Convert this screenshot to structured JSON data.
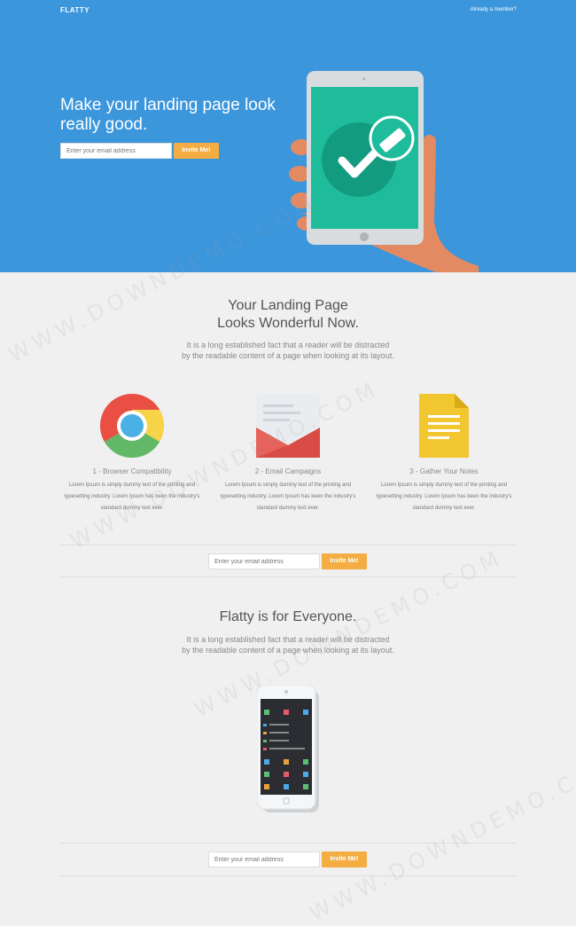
{
  "header": {
    "brand": "FLATTY",
    "member_link": "Already a member?"
  },
  "hero": {
    "title": "Make your landing page look really good.",
    "email_placeholder": "Enter your email address",
    "button": "Invite Me!"
  },
  "section1": {
    "title_line1": "Your Landing Page",
    "title_line2": "Looks Wonderful Now.",
    "subtitle": "It is a long established fact that a reader will be distracted by the readable content of a page when looking at its layout."
  },
  "features": [
    {
      "title": "1 - Browser Compatibility",
      "body": "Lorem Ipsum is simply dummy text of the printing and typesetting industry. Lorem Ipsum has been the industry's standard dummy text ever.",
      "icon": "chrome-icon"
    },
    {
      "title": "2 - Email Campaigns",
      "body": "Lorem Ipsum is simply dummy text of the printing and typesetting industry. Lorem Ipsum has been the industry's standard dummy text ever.",
      "icon": "envelope-icon"
    },
    {
      "title": "3 - Gather Your Notes",
      "body": "Lorem Ipsum is simply dummy text of the printing and typesetting industry. Lorem Ipsum has been the industry's standard dummy text ever.",
      "icon": "notes-icon"
    }
  ],
  "cta1": {
    "email_placeholder": "Enter your email address",
    "button": "Invite Me!"
  },
  "section2": {
    "title": "Flatty is for Everyone.",
    "subtitle": "It is a long established fact that a reader will be distracted by the readable content of a page when looking at its layout."
  },
  "cta2": {
    "email_placeholder": "Enter your email address",
    "button": "Invite Me!"
  },
  "watermark": "WWW.DOWNDEMO.COM",
  "colors": {
    "hero_bg": "#3b96dc",
    "accent": "#f4ad42",
    "tablet_screen": "#1fbc9c",
    "page_bg": "#f0f0f0"
  }
}
